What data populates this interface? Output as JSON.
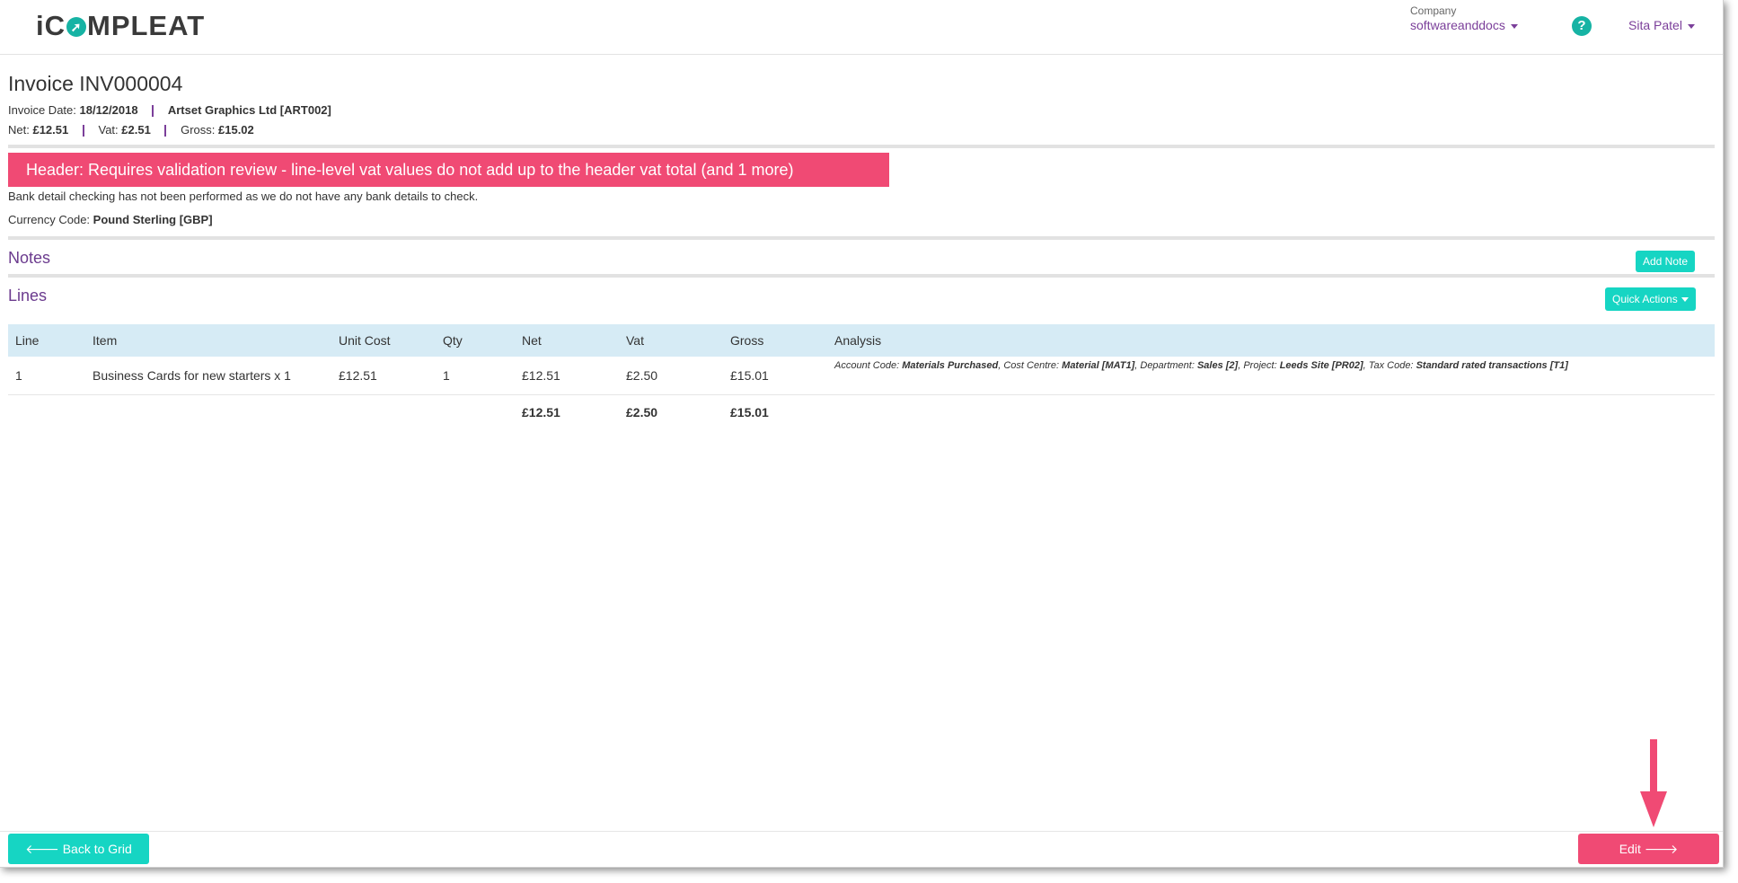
{
  "header": {
    "logo_before": "iC",
    "logo_after": "MPLEAT",
    "company_label": "Company",
    "company_value": "softwareanddocs",
    "help_glyph": "?",
    "user_name": "Sita Patel"
  },
  "invoice": {
    "title": "Invoice INV000004",
    "date_label": "Invoice Date:",
    "date_value": "18/12/2018",
    "supplier": "Artset Graphics Ltd [ART002]",
    "net_label": "Net:",
    "net_value": "£12.51",
    "vat_label": "Vat:",
    "vat_value": "£2.51",
    "gross_label": "Gross:",
    "gross_value": "£15.02"
  },
  "alert": {
    "text": "Header: Requires validation review -  line-level vat values do not add up to the header vat total (and 1 more)",
    "color": "#f04a74"
  },
  "bank_note": "Bank detail checking has not been performed as we do not have any bank details to check.",
  "currency": {
    "label": "Currency Code:",
    "value": "Pound Sterling [GBP]"
  },
  "notes": {
    "title": "Notes",
    "add_button": "Add Note"
  },
  "lines": {
    "title": "Lines",
    "quick_actions": "Quick Actions",
    "columns": [
      "Line",
      "Item",
      "Unit Cost",
      "Qty",
      "Net",
      "Vat",
      "Gross",
      "Analysis"
    ],
    "rows": [
      {
        "line": "1",
        "item": "Business Cards for new starters x 1",
        "unit_cost": "£12.51",
        "qty": "1",
        "net": "£12.51",
        "vat": "£2.50",
        "gross": "£15.01",
        "analysis": {
          "account_label": "Account Code:",
          "account_value": "Materials Purchased",
          "cost_label": "Cost Centre:",
          "cost_value": "Material [MAT1]",
          "dept_label": "Department:",
          "dept_value": "Sales [2]",
          "project_label": "Project:",
          "project_value": "Leeds Site [PR02]",
          "tax_label": "Tax Code:",
          "tax_value": "Standard rated transactions [T1]"
        }
      }
    ],
    "totals": {
      "net": "£12.51",
      "vat": "£2.50",
      "gross": "£15.01"
    }
  },
  "footer": {
    "back_label": "Back to Grid",
    "edit_label": "Edit"
  },
  "colors": {
    "teal": "#16d5c3",
    "pink": "#f04a74",
    "purple": "#7b3f9a"
  }
}
